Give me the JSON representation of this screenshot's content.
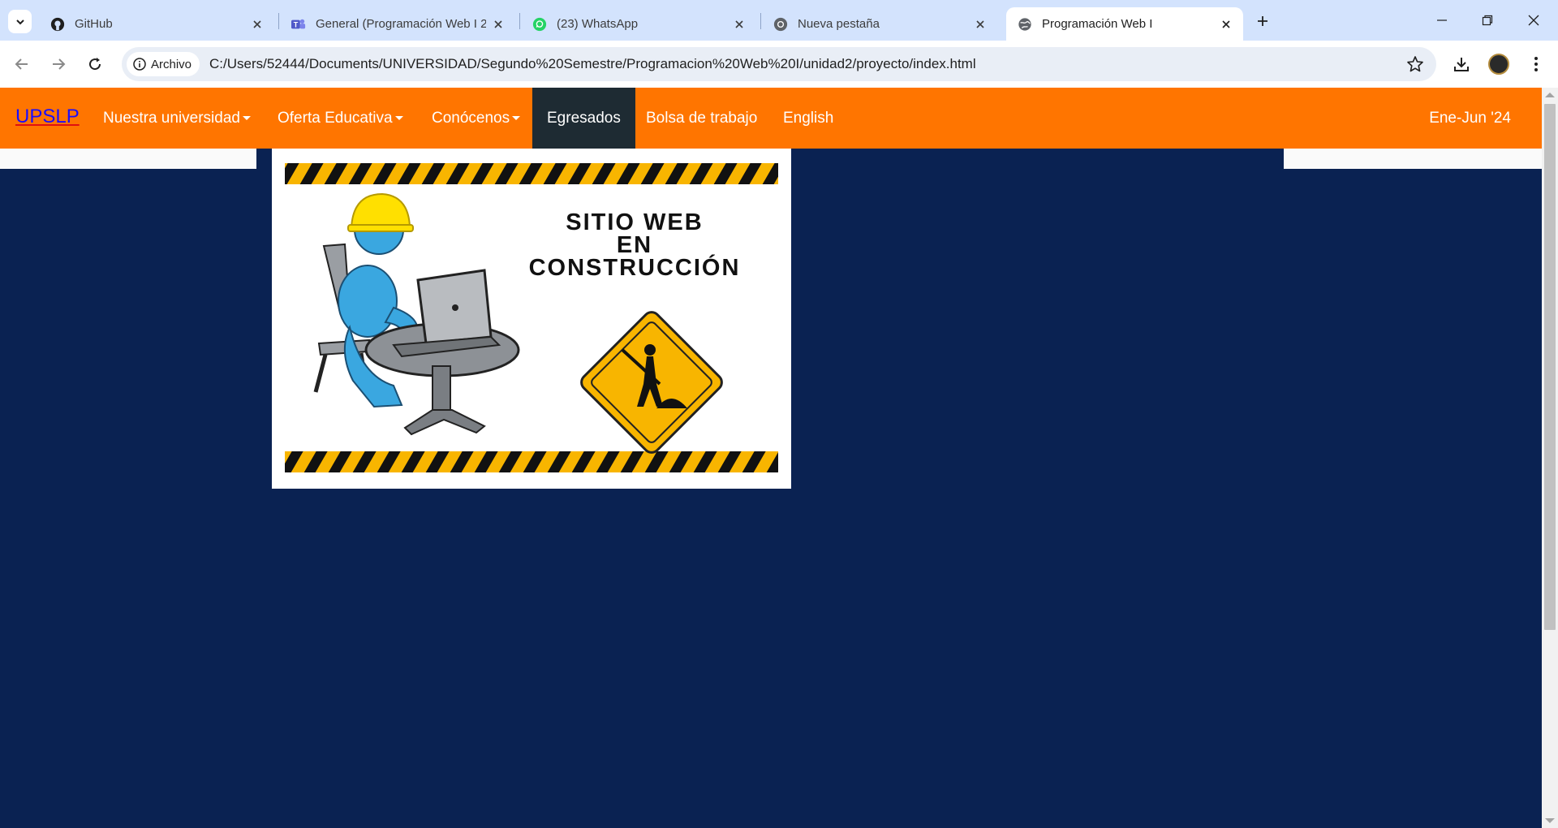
{
  "browser": {
    "tabs": [
      {
        "title": "GitHub",
        "icon": "github-icon"
      },
      {
        "title": "General (Programación Web I 2…",
        "icon": "teams-icon"
      },
      {
        "title": "(23) WhatsApp",
        "icon": "whatsapp-icon"
      },
      {
        "title": "Nueva pestaña",
        "icon": "chrome-icon"
      },
      {
        "title": "Programación Web I",
        "icon": "globe-icon",
        "active": true
      }
    ],
    "site_chip": "Archivo",
    "url": "C:/Users/52444/Documents/UNIVERSIDAD/Segundo%20Semestre/Programacion%20Web%20I/unidad2/proyecto/index.html"
  },
  "page": {
    "brand": "UPSLP",
    "nav": [
      {
        "label": "Nuestra universidad",
        "dropdown": true
      },
      {
        "label": "Oferta Educativa",
        "dropdown": true
      },
      {
        "label": "Conócenos",
        "dropdown": true
      },
      {
        "label": "Egresados",
        "active": true
      },
      {
        "label": "Bolsa de trabajo"
      },
      {
        "label": "English"
      }
    ],
    "term": "Ene-Jun '24",
    "banner": {
      "line1": "SITIO WEB",
      "line2": "EN",
      "line3": "CONSTRUCCIÓN"
    }
  },
  "colors": {
    "navbar": "#ff7500",
    "page_bg": "#0a2252",
    "active_nav": "#1e2b33",
    "hazard_yellow": "#f8b500"
  }
}
